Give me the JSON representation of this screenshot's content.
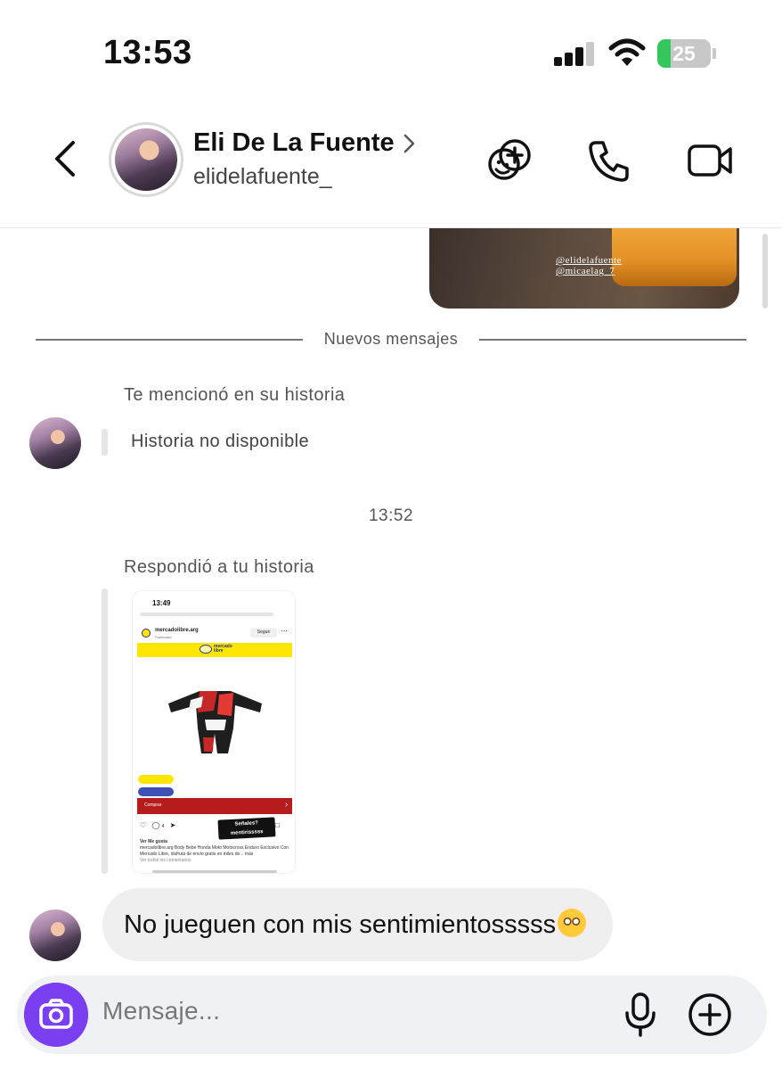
{
  "status_bar": {
    "time": "13:53",
    "battery": "25",
    "battery_level": 0.25,
    "battery_color": "#34c759"
  },
  "header": {
    "contact_name": "Eli De La Fuente",
    "username": "elidelafuente_",
    "icons": [
      "back-chevron-icon",
      "chevron-right-icon",
      "effects-icon",
      "phone-icon",
      "video-camera-icon"
    ]
  },
  "previous_message": {
    "tags": [
      "@elidelafuente",
      "@micaelag_7"
    ]
  },
  "divider": {
    "label": "Nuevos mensajes"
  },
  "mention": {
    "note": "Te mencionó en su historia",
    "unavailable": "Historia no disponible"
  },
  "timestamp": "13:52",
  "story_reply": {
    "note": "Respondió a tu historia",
    "thumbnail": {
      "time": "13:49",
      "account": "mercadolibre.arg",
      "sponsored": "Publicidad",
      "follow": "Seguir",
      "brand_top": "mercado",
      "brand_bottom": "libre",
      "buy": "Comprar",
      "sticker_line1": "Señales?",
      "sticker_line2": "mentirisssss",
      "likes": "Ver Me gusta",
      "caption": "mercadolibre.arg Body Bebe Honda Moto Motocross Enduro Exclusivo Con Mercado Libre, disfrutá de envío gratis en miles de... más",
      "comments": "Ver todos los comentarios",
      "comment_count": "4",
      "accent_yellow": "#ffe600",
      "accent_red": "#b61c1c"
    }
  },
  "message": {
    "text": "No jueguen con mis sentimientosssss"
  },
  "composer": {
    "placeholder": "Mensaje...",
    "camera_color": "#7b3ff2"
  }
}
